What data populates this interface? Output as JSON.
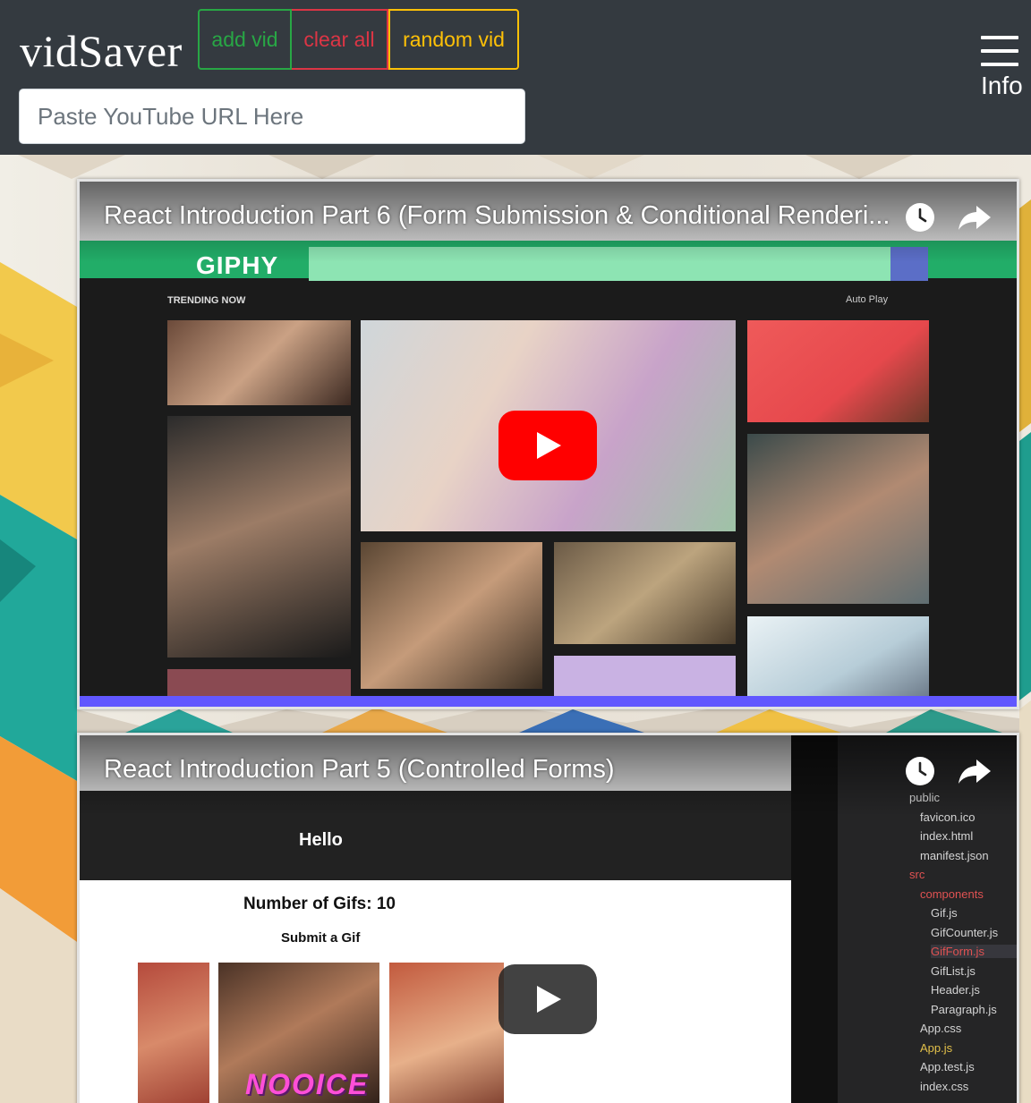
{
  "header": {
    "brand": "vidSaver",
    "buttons": {
      "add": "add vid",
      "clear": "clear all",
      "random": "random vid"
    },
    "url_placeholder": "Paste YouTube URL Here",
    "menu_label": "Info"
  },
  "colors": {
    "navbar": "#343a40",
    "add": "#28a745",
    "clear": "#dc3545",
    "random": "#ffc107",
    "youtube_red": "#ff0000"
  },
  "videos": [
    {
      "title": "React Introduction Part 6 (Form Submission & Conditional Renderi...",
      "icons": [
        "watch-later-icon",
        "share-icon",
        "play-icon"
      ],
      "content": {
        "logo": "GIPHY",
        "trending": "TRENDING NOW",
        "autoplay": "Auto Play"
      }
    },
    {
      "title": "React Introduction Part 5 (Controlled Forms)",
      "icons": [
        "watch-later-icon",
        "share-icon",
        "play-icon"
      ],
      "content": {
        "hello": "Hello",
        "count": "Number of Gifs: 10",
        "submit": "Submit a Gif",
        "gif_caption": "NOOICE",
        "explorer_files": [
          "public",
          "favicon.ico",
          "index.html",
          "manifest.json",
          "src",
          "components",
          "Gif.js",
          "GifCounter.js",
          "GifForm.js",
          "GifList.js",
          "Header.js",
          "Paragraph.js",
          "App.css",
          "App.js",
          "App.test.js",
          "index.css"
        ]
      }
    }
  ]
}
